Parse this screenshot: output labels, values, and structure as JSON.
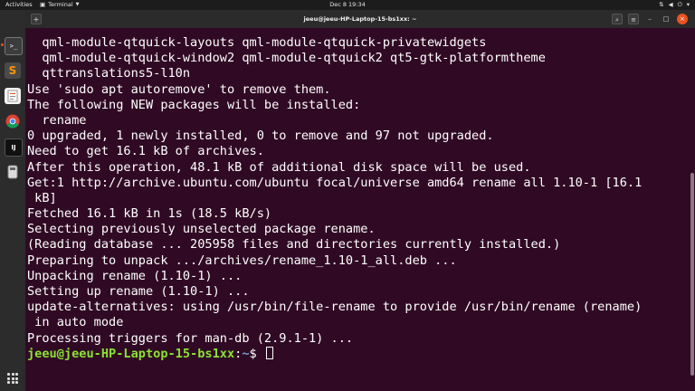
{
  "topbar": {
    "activities": "Activities",
    "app_name": "Terminal",
    "clock": "Dec 8  19:34",
    "tray_icons": [
      "network-icon",
      "volume-icon",
      "power-icon"
    ]
  },
  "window": {
    "title": "jeeu@jeeu-HP-Laptop-15-bs1xx: ~",
    "new_tab_symbol": "⊞",
    "search_symbol": "🔍",
    "menu_symbol": "≡",
    "minimize_symbol": "–",
    "maximize_symbol": "□",
    "close_symbol": "×"
  },
  "dock": {
    "items": [
      {
        "name": "terminal-app",
        "color": "#3c3c3c",
        "label": ">_"
      },
      {
        "name": "sublime-text-app",
        "color": "#ff9800",
        "label": "S"
      },
      {
        "name": "text-editor-app",
        "color": "#e8e8e8",
        "label": ""
      },
      {
        "name": "chrome-app",
        "color": "#34a853",
        "label": ""
      },
      {
        "name": "intellij-app",
        "color": "#111111",
        "label": "IJ"
      },
      {
        "name": "removable-drive-app",
        "color": "#dcdcdc",
        "label": ""
      }
    ]
  },
  "terminal": {
    "lines": [
      "  qml-module-qtquick-layouts qml-module-qtquick-privatewidgets",
      "  qml-module-qtquick-window2 qml-module-qtquick2 qt5-gtk-platformtheme",
      "  qttranslations5-l10n",
      "Use 'sudo apt autoremove' to remove them.",
      "The following NEW packages will be installed:",
      "  rename",
      "0 upgraded, 1 newly installed, 0 to remove and 97 not upgraded.",
      "Need to get 16.1 kB of archives.",
      "After this operation, 48.1 kB of additional disk space will be used.",
      "Get:1 http://archive.ubuntu.com/ubuntu focal/universe amd64 rename all 1.10-1 [16.1",
      " kB]",
      "Fetched 16.1 kB in 1s (18.5 kB/s)",
      "Selecting previously unselected package rename.",
      "(Reading database ... 205958 files and directories currently installed.)",
      "Preparing to unpack .../archives/rename_1.10-1_all.deb ...",
      "Unpacking rename (1.10-1) ...",
      "Setting up rename (1.10-1) ...",
      "update-alternatives: using /usr/bin/file-rename to provide /usr/bin/rename (rename)",
      " in auto mode",
      "Processing triggers for man-db (2.9.1-1) ..."
    ],
    "prompt_user": "jeeu@jeeu-HP-Laptop-15-bs1xx",
    "prompt_sep": ":",
    "prompt_path": "~",
    "prompt_symbol": "$ "
  },
  "colors": {
    "terminal_bg": "#300a24",
    "prompt_user": "#8ae234",
    "prompt_path": "#729fcf",
    "accent": "#e95420"
  }
}
